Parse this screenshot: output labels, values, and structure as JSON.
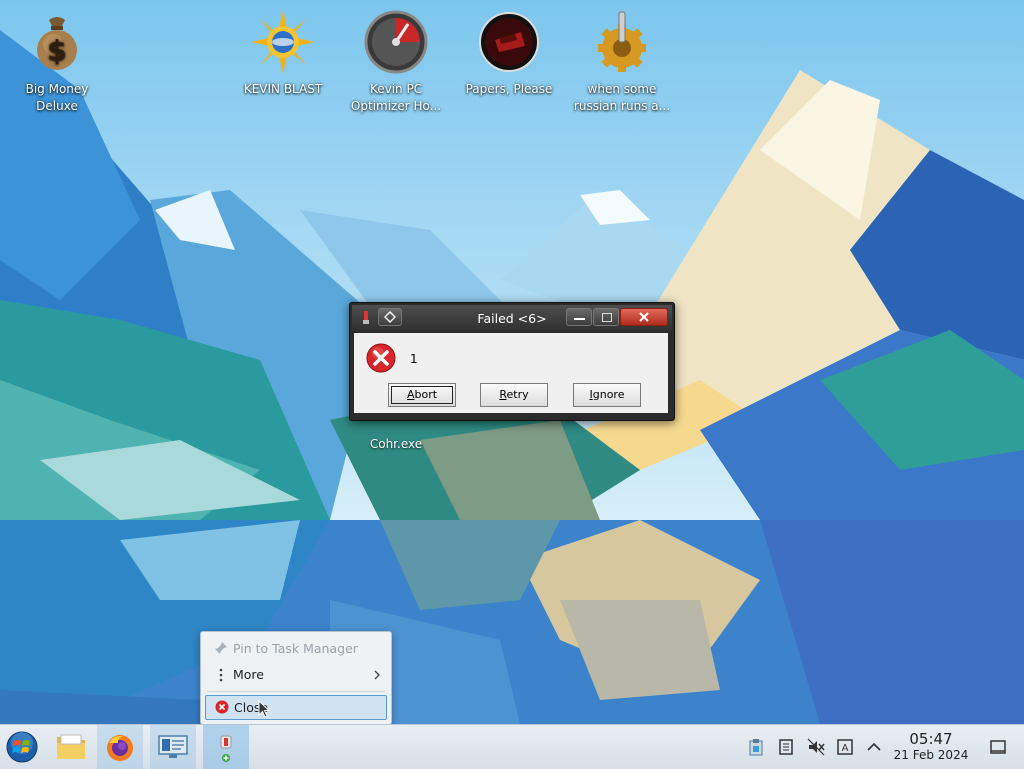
{
  "desktop": {
    "icons": [
      {
        "label": "Big Money\nDeluxe",
        "icon": "money-bag-icon"
      },
      {
        "label": "KEVIN BLAST",
        "icon": "sun-globe-icon"
      },
      {
        "label": "Kevin PC\nOptimizer Ho...",
        "icon": "gauge-icon"
      },
      {
        "label": "Papers, Please",
        "icon": "papers-please-icon"
      },
      {
        "label": "when some\nrussian runs a...",
        "icon": "gear-icon"
      }
    ],
    "cohr_label": "Cohr.exe"
  },
  "dialog": {
    "title": "Failed <6>",
    "message": "1",
    "buttons": {
      "abort": "Abort",
      "retry": "Retry",
      "ignore": "Ignore"
    },
    "mnemonics": {
      "abort": "A",
      "retry": "R",
      "ignore": "I"
    }
  },
  "context_menu": {
    "pin": "Pin to Task Manager",
    "more": "More",
    "close": "Close"
  },
  "taskbar": {
    "time": "05:47",
    "date": "21 Feb 2024"
  },
  "colors": {
    "taskbar_bg": "#dfe6ec",
    "menu_highlight": "#cfe3f3",
    "error_red": "#d9262a"
  }
}
